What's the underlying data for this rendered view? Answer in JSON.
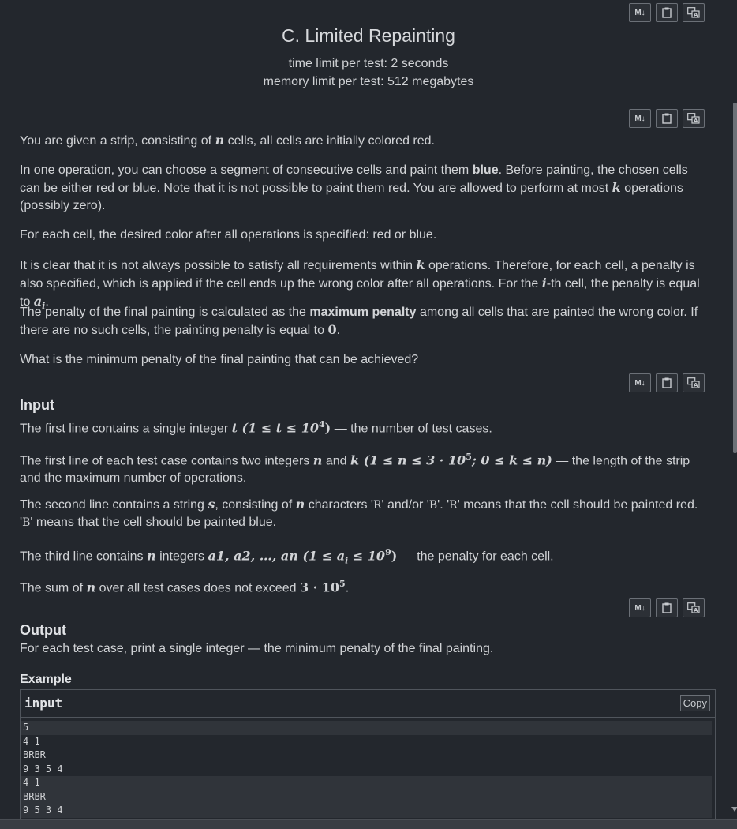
{
  "problem": {
    "title": "C. Limited Repainting",
    "time_limit": "time limit per test: 2 seconds",
    "memory_limit": "memory limit per test: 512 megabytes"
  },
  "toolbar": {
    "md_label": "M↓"
  },
  "statement": {
    "p1": {
      "a": "You are given a strip, consisting of ",
      "n": "n",
      "b": " cells, all cells are initially colored red."
    },
    "p2": {
      "a": "In one operation, you can choose a segment of consecutive cells and paint them ",
      "blue": "blue",
      "b": ". Before painting, the chosen cells can be either red or blue. Note that it is not possible to paint them red. You are allowed to perform at most ",
      "k": "k",
      "c": " operations (possibly zero)."
    },
    "p3": "For each cell, the desired color after all operations is specified: red or blue.",
    "p4": {
      "a": "It is clear that it is not always possible to satisfy all requirements within ",
      "k": "k",
      "b": " operations. Therefore, for each cell, a penalty is also specified, which is applied if the cell ends up the wrong color after all operations. For the ",
      "i": "i",
      "c": "-th cell, the penalty is equal to ",
      "ai": "a",
      "ai_sub": "i",
      "d": "."
    },
    "p5": {
      "a": "The penalty of the final painting is calculated as the ",
      "bold": "maximum penalty",
      "b": " among all cells that are painted the wrong color. If there are no such cells, the painting penalty is equal to ",
      "zero": "0",
      "c": "."
    },
    "p6": "What is the minimum penalty of the final painting that can be achieved?"
  },
  "input_section": {
    "title": "Input",
    "p1": {
      "a": "The first line contains a single integer ",
      "math": "t (1 ≤ t ≤ 10",
      "sup": "4",
      "math_end": ")",
      "b": " — the number of test cases."
    },
    "p2": {
      "a": "The first line of each test case contains two integers ",
      "n": "n",
      "and": " and ",
      "k": "k",
      "math": " (1 ≤ n ≤ 3 · 10",
      "sup": "5",
      "math2": "; 0 ≤ k ≤ n)",
      "b": " — the length of the strip and the maximum number of operations."
    },
    "p3": {
      "a": "The second line contains a string ",
      "s": "s",
      "b": ", consisting of ",
      "n": "n",
      "c": " characters '",
      "r1": "R",
      "d": "' and/or '",
      "b1": "B",
      "e": "'. '",
      "r2": "R",
      "f": "' means that the cell should be painted red. '",
      "b2": "B",
      "g": "' means that the cell should be painted blue."
    },
    "p4": {
      "a": "The third line contains ",
      "n": "n",
      "b": " integers ",
      "seq": "a",
      "seq_rest": "1, a2, …, an",
      "math": " (1 ≤ a",
      "math_sub": "i",
      "math2": " ≤ 10",
      "sup": "9",
      "math3": ")",
      "c": " — the penalty for each cell."
    },
    "p5": {
      "a": "The sum of ",
      "n": "n",
      "b": " over all test cases does not exceed ",
      "math": "3 · 10",
      "sup": "5",
      "c": "."
    }
  },
  "output_section": {
    "title": "Output",
    "p1": "For each test case, print a single integer — the minimum penalty of the final painting."
  },
  "example": {
    "title": "Example",
    "input_label": "input",
    "copy_label": "Copy",
    "lines": [
      "5",
      "4 1",
      "BRBR",
      "9 3 5 4",
      "4 1",
      "BRBR",
      "9 5 3 4"
    ]
  }
}
